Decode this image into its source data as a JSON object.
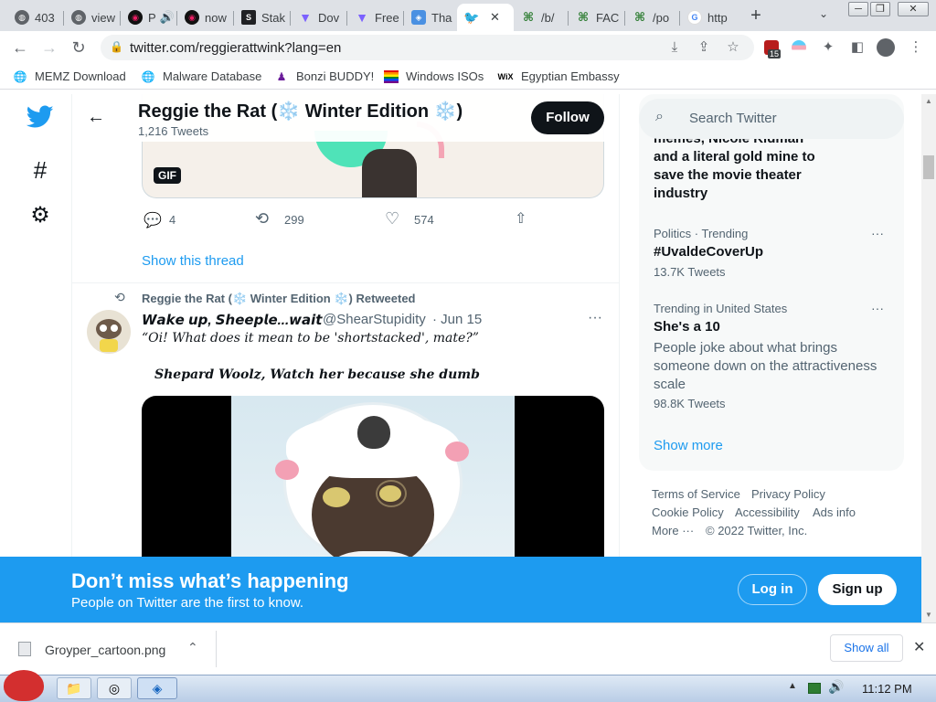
{
  "browser": {
    "tabs": [
      {
        "label": "403",
        "favicon": "globe-icon",
        "color": "#5f6368"
      },
      {
        "label": "view",
        "favicon": "globe-icon",
        "color": "#5f6368"
      },
      {
        "label": "P",
        "favicon": "eye-icon",
        "color": "#e91e63",
        "audio": true
      },
      {
        "label": "now",
        "favicon": "eye-icon",
        "color": "#e91e63"
      },
      {
        "label": "Stak",
        "favicon": "s-icon",
        "color": "#202124"
      },
      {
        "label": "Dov",
        "favicon": "triangle-icon",
        "color": "#7b61ff"
      },
      {
        "label": "Free",
        "favicon": "triangle-icon",
        "color": "#7b61ff"
      },
      {
        "label": "Tha",
        "favicon": "shield-icon",
        "color": "#4a90e2"
      },
      {
        "label": "",
        "favicon": "twitter-icon",
        "color": "#1d9bf0",
        "active": true
      },
      {
        "label": "/b/",
        "favicon": "clover-icon",
        "color": "#2e7d32"
      },
      {
        "label": "FAC",
        "favicon": "clover-icon",
        "color": "#2e7d32"
      },
      {
        "label": "/po",
        "favicon": "clover-icon",
        "color": "#2e7d32"
      },
      {
        "label": "http",
        "favicon": "google-icon",
        "color": "#4285f4"
      }
    ],
    "new_tab": "+",
    "url": "twitter.com/reggierattwink?lang=en",
    "extension_badge": "15",
    "bookmarks": [
      {
        "label": "MEMZ Download",
        "icon": "globe-icon"
      },
      {
        "label": "Malware Database",
        "icon": "globe-icon"
      },
      {
        "label": "Bonzi BUDDY!",
        "icon": "bonzi-icon"
      },
      {
        "label": "Windows ISOs",
        "icon": "rainbow-flag-icon"
      },
      {
        "label": "Egyptian Embassy",
        "icon": "wix-icon"
      }
    ]
  },
  "profile": {
    "name": "Reggie the Rat (❄️ Winter Edition ❄️)",
    "tweet_count": "1,216 Tweets",
    "follow_label": "Follow"
  },
  "tweet1": {
    "gif_label": "GIF",
    "replies": "4",
    "retweets": "299",
    "likes": "574",
    "show_thread": "Show this thread"
  },
  "tweet2": {
    "retweeted_by": "Reggie the Rat (❄️ Winter Edition ❄️) Retweeted",
    "author_name": "𝙒𝙖𝙠𝙚 𝙪𝙥, 𝙎𝙝𝙚𝙚𝙥𝙡𝙚...𝙬𝙖𝙞𝙩",
    "handle": "@ShearStupidity",
    "date": "· Jun 15",
    "text_line1": "“Oi! What does it mean to be 'shortstacked', mate?”",
    "text_line2": "Shepard Woolz, Watch her because she dumb"
  },
  "search_placeholder": "Search Twitter",
  "trends": {
    "partial_top": "memes, Nicole Kidman",
    "partial_lines": [
      "and a literal gold mine to",
      "save the movie theater",
      "industry"
    ],
    "items": [
      {
        "context": "Politics · Trending",
        "title": "#UvaldeCoverUp",
        "count": "13.7K Tweets"
      },
      {
        "context": "Trending in United States",
        "title": "She's a 10",
        "desc": [
          "People joke about what brings",
          "someone down on the attractiveness",
          "scale"
        ],
        "count": "98.8K Tweets"
      }
    ],
    "show_more": "Show more"
  },
  "footer": {
    "links_row1": [
      "Terms of Service",
      "Privacy Policy"
    ],
    "links_row2": [
      "Cookie Policy",
      "Accessibility",
      "Ads info"
    ],
    "more": "More ···",
    "copyright": "© 2022 Twitter, Inc."
  },
  "banner": {
    "title": "Don’t miss what’s happening",
    "subtitle": "People on Twitter are the first to know.",
    "login": "Log in",
    "signup": "Sign up"
  },
  "download": {
    "filename": "Groyper_cartoon.png",
    "show_all": "Show all"
  },
  "taskbar": {
    "clock": "11:12 PM"
  },
  "colors": {
    "twitter_blue": "#1d9bf0",
    "text_primary": "#0f1419",
    "text_secondary": "#536471"
  }
}
